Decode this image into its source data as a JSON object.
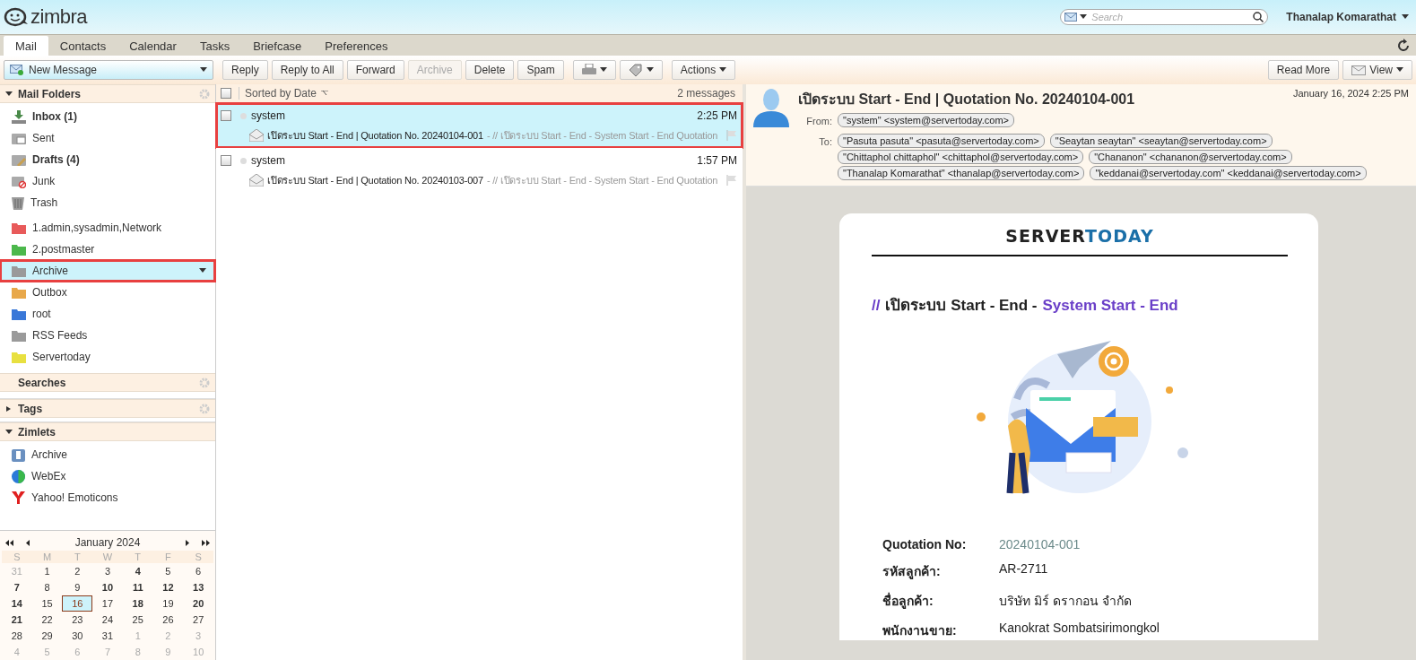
{
  "header": {
    "logo": "zimbra",
    "search": {
      "placeholder": "Search"
    },
    "user": "Thanalap Komarathat"
  },
  "app_tabs": [
    {
      "label": "Mail",
      "selected": true
    },
    {
      "label": "Contacts",
      "selected": false
    },
    {
      "label": "Calendar",
      "selected": false
    },
    {
      "label": "Tasks",
      "selected": false
    },
    {
      "label": "Briefcase",
      "selected": false
    },
    {
      "label": "Preferences",
      "selected": false
    }
  ],
  "toolbar": {
    "new_message": "New Message",
    "buttons": [
      {
        "kind": "text",
        "label": "Reply",
        "disabled": false
      },
      {
        "kind": "text",
        "label": "Reply to All",
        "disabled": false
      },
      {
        "kind": "text",
        "label": "Forward",
        "disabled": false
      },
      {
        "kind": "text",
        "label": "Archive",
        "disabled": true
      },
      {
        "kind": "text",
        "label": "Delete",
        "disabled": false
      },
      {
        "kind": "text",
        "label": "Spam",
        "disabled": false
      },
      {
        "kind": "print",
        "disabled": false
      },
      {
        "kind": "tag",
        "disabled": false
      },
      {
        "kind": "menu",
        "label": "Actions",
        "disabled": false
      }
    ],
    "right_buttons": [
      {
        "kind": "text",
        "label": "Read More"
      },
      {
        "kind": "menu",
        "label": "View"
      }
    ]
  },
  "mail_folders": {
    "title": "Mail Folders",
    "expanded": true,
    "items": [
      {
        "label": "Inbox (1)",
        "kind": "inbox",
        "unread": true,
        "selected": false,
        "marked": false
      },
      {
        "label": "Sent",
        "kind": "sent",
        "unread": false,
        "selected": false,
        "marked": false
      },
      {
        "label": "Drafts (4)",
        "kind": "drafts",
        "unread": true,
        "selected": false,
        "marked": false
      },
      {
        "label": "Junk",
        "kind": "junk",
        "unread": false,
        "selected": false,
        "marked": false
      },
      {
        "label": "Trash",
        "kind": "trash",
        "unread": false,
        "selected": false,
        "marked": false
      },
      {
        "label": "1.admin,sysadmin,Network",
        "kind": "folder",
        "color": "#e85a5a",
        "unread": false,
        "selected": false,
        "marked": false
      },
      {
        "label": "2.postmaster",
        "kind": "folder",
        "color": "#4cb84c",
        "unread": false,
        "selected": false,
        "marked": false
      },
      {
        "label": "Archive",
        "kind": "folder",
        "color": "#9a9a9a",
        "unread": false,
        "selected": true,
        "marked": true
      },
      {
        "label": "Outbox",
        "kind": "folder",
        "color": "#e8a84a",
        "unread": false,
        "selected": false,
        "marked": false
      },
      {
        "label": "root",
        "kind": "folder",
        "color": "#3a78d8",
        "unread": false,
        "selected": false,
        "marked": false
      },
      {
        "label": "RSS Feeds",
        "kind": "folder",
        "color": "#9a9a9a",
        "unread": false,
        "selected": false,
        "marked": false
      },
      {
        "label": "Servertoday",
        "kind": "folder",
        "color": "#e8e040",
        "unread": false,
        "selected": false,
        "marked": false
      }
    ]
  },
  "searches": {
    "title": "Searches"
  },
  "tags": {
    "title": "Tags",
    "expanded": false
  },
  "zimlets": {
    "title": "Zimlets",
    "expanded": true,
    "items": [
      {
        "label": "Archive",
        "kind": "archive"
      },
      {
        "label": "WebEx",
        "kind": "globe"
      },
      {
        "label": "Yahoo! Emoticons",
        "kind": "yahoo"
      }
    ]
  },
  "mini_calendar": {
    "month": "January 2024",
    "weekdays": [
      "S",
      "M",
      "T",
      "W",
      "T",
      "F",
      "S"
    ],
    "weeks": [
      [
        {
          "n": "31",
          "kind": "other"
        },
        {
          "n": "1",
          "kind": "normal"
        },
        {
          "n": "2",
          "kind": "normal"
        },
        {
          "n": "3",
          "kind": "normal"
        },
        {
          "n": "4",
          "kind": "bold"
        },
        {
          "n": "5",
          "kind": "normal"
        },
        {
          "n": "6",
          "kind": "normal"
        }
      ],
      [
        {
          "n": "7",
          "kind": "bold"
        },
        {
          "n": "8",
          "kind": "normal"
        },
        {
          "n": "9",
          "kind": "normal"
        },
        {
          "n": "10",
          "kind": "bold"
        },
        {
          "n": "11",
          "kind": "bold"
        },
        {
          "n": "12",
          "kind": "bold"
        },
        {
          "n": "13",
          "kind": "bold"
        }
      ],
      [
        {
          "n": "14",
          "kind": "bold"
        },
        {
          "n": "15",
          "kind": "normal"
        },
        {
          "n": "16",
          "kind": "today"
        },
        {
          "n": "17",
          "kind": "normal"
        },
        {
          "n": "18",
          "kind": "bold"
        },
        {
          "n": "19",
          "kind": "normal"
        },
        {
          "n": "20",
          "kind": "bold"
        }
      ],
      [
        {
          "n": "21",
          "kind": "bold"
        },
        {
          "n": "22",
          "kind": "normal"
        },
        {
          "n": "23",
          "kind": "normal"
        },
        {
          "n": "24",
          "kind": "normal"
        },
        {
          "n": "25",
          "kind": "normal"
        },
        {
          "n": "26",
          "kind": "normal"
        },
        {
          "n": "27",
          "kind": "normal"
        }
      ],
      [
        {
          "n": "28",
          "kind": "normal"
        },
        {
          "n": "29",
          "kind": "normal"
        },
        {
          "n": "30",
          "kind": "normal"
        },
        {
          "n": "31",
          "kind": "normal"
        },
        {
          "n": "1",
          "kind": "other"
        },
        {
          "n": "2",
          "kind": "other"
        },
        {
          "n": "3",
          "kind": "other"
        }
      ],
      [
        {
          "n": "4",
          "kind": "other"
        },
        {
          "n": "5",
          "kind": "other"
        },
        {
          "n": "6",
          "kind": "other"
        },
        {
          "n": "7",
          "kind": "other"
        },
        {
          "n": "8",
          "kind": "other"
        },
        {
          "n": "9",
          "kind": "other"
        },
        {
          "n": "10",
          "kind": "other"
        }
      ]
    ]
  },
  "message_list": {
    "all_checked": false,
    "sort_label": "Sorted by Date",
    "count": "2 messages",
    "messages": [
      {
        "sender": "system",
        "time": "2:25 PM",
        "subject": "เปิดระบบ Start - End | Quotation No. 20240104-001",
        "fragment": "- // เปิดระบบ Start - End - System Start - End Quotation",
        "checked": false,
        "selected": true,
        "marked": true
      },
      {
        "sender": "system",
        "time": "1:57 PM",
        "subject": "เปิดระบบ Start - End | Quotation No. 20240103-007",
        "fragment": "- // เปิดระบบ Start - End - System Start - End Quotation",
        "checked": false,
        "selected": false,
        "marked": false
      }
    ]
  },
  "reading_pane": {
    "subject": "เปิดระบบ Start - End | Quotation No. 20240104-001",
    "date": "January 16, 2024 2:25 PM",
    "from_label": "From:",
    "from": "\"system\" <system@servertoday.com>",
    "to_label": "To:",
    "to": [
      [
        "\"Pasuta pasuta\" <pasuta@servertoday.com>",
        "\"Seaytan seaytan\" <seaytan@servertoday.com>"
      ],
      [
        "\"Chittaphol chittaphol\" <chittaphol@servertoday.com>",
        "\"Chananon\" <chananon@servertoday.com>"
      ],
      [
        "\"Thanalap Komarathat\" <thanalap@servertoday.com>",
        "\"keddanai@servertoday.com\" <keddanai@servertoday.com>"
      ]
    ],
    "body": {
      "logo": [
        {
          "text": "SERVER",
          "color": "#222222"
        },
        {
          "text": "TODAY",
          "color": "#1a6fa8"
        }
      ],
      "heading": [
        {
          "text": "//",
          "accent": true
        },
        {
          "text": "เปิดระบบ Start - End -",
          "accent": false
        },
        {
          "text": "System Start - End",
          "accent": true
        }
      ],
      "details": [
        {
          "label": "Quotation No:",
          "value": "20240104-001",
          "muted": true
        },
        {
          "label": "รหัสลูกค้า:",
          "value": "AR-2711",
          "muted": false
        },
        {
          "label": "ชื่อลูกค้า:",
          "value": "บริษัท มิร์ ดรากอน จำกัด",
          "muted": false
        },
        {
          "label": "พนักงานขาย:",
          "value": "Kanokrat Sombatsirimongkol",
          "muted": false
        }
      ]
    }
  }
}
